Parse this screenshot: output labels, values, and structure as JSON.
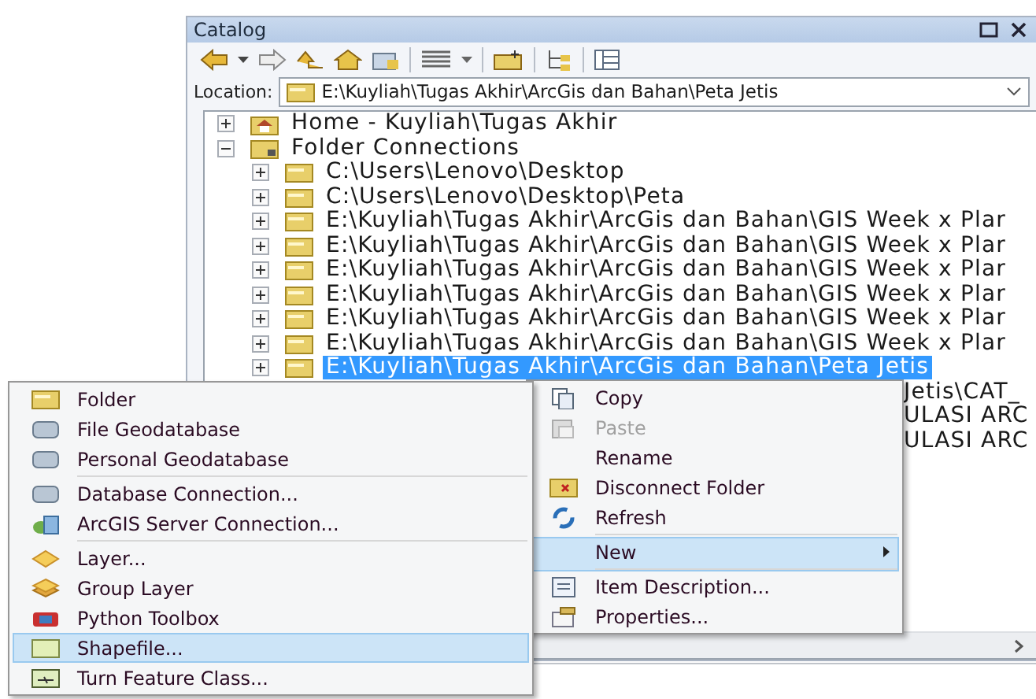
{
  "panel": {
    "title": "Catalog"
  },
  "location": {
    "label": "Location:",
    "value": "E:\\Kuyliah\\Tugas Akhir\\ArcGis dan Bahan\\Peta Jetis"
  },
  "tree": [
    {
      "label": "Home - Kuyliah\\Tugas Akhir",
      "kind": "home",
      "expanded": false,
      "selected": false
    },
    {
      "label": "Folder Connections",
      "kind": "connections",
      "expanded": true,
      "selected": false,
      "children": [
        {
          "label": "C:\\Users\\Lenovo\\Desktop",
          "kind": "folder",
          "expanded": false,
          "selected": false
        },
        {
          "label": "C:\\Users\\Lenovo\\Desktop\\Peta",
          "kind": "folder",
          "expanded": false,
          "selected": false
        },
        {
          "label": "E:\\Kuyliah\\Tugas Akhir\\ArcGis dan Bahan\\GIS Week x Plar",
          "kind": "folder",
          "expanded": false,
          "selected": false
        },
        {
          "label": "E:\\Kuyliah\\Tugas Akhir\\ArcGis dan Bahan\\GIS Week x Plar",
          "kind": "folder",
          "expanded": false,
          "selected": false
        },
        {
          "label": "E:\\Kuyliah\\Tugas Akhir\\ArcGis dan Bahan\\GIS Week x Plar",
          "kind": "folder",
          "expanded": false,
          "selected": false
        },
        {
          "label": "E:\\Kuyliah\\Tugas Akhir\\ArcGis dan Bahan\\GIS Week x Plar",
          "kind": "folder",
          "expanded": false,
          "selected": false
        },
        {
          "label": "E:\\Kuyliah\\Tugas Akhir\\ArcGis dan Bahan\\GIS Week x Plar",
          "kind": "folder",
          "expanded": false,
          "selected": false
        },
        {
          "label": "E:\\Kuyliah\\Tugas Akhir\\ArcGis dan Bahan\\GIS Week x Plar",
          "kind": "folder",
          "expanded": false,
          "selected": false
        },
        {
          "label": "E:\\Kuyliah\\Tugas Akhir\\ArcGis dan Bahan\\Peta Jetis",
          "kind": "folder",
          "expanded": false,
          "selected": true
        },
        {
          "label": "Jetis\\CAT_",
          "kind": "fragment"
        },
        {
          "label": "ULASI ARC",
          "kind": "fragment"
        },
        {
          "label": "ULASI ARC",
          "kind": "fragment"
        }
      ]
    }
  ],
  "context_menu": [
    {
      "label": "Copy",
      "kind": "copy",
      "disabled": false,
      "selected": false,
      "separator_after": false
    },
    {
      "label": "Paste",
      "kind": "paste",
      "disabled": true,
      "selected": false,
      "separator_after": false
    },
    {
      "label": "Rename",
      "kind": "plain",
      "disabled": false,
      "selected": false,
      "separator_after": false
    },
    {
      "label": "Disconnect Folder",
      "kind": "disconnect",
      "disabled": false,
      "selected": false,
      "separator_after": false
    },
    {
      "label": "Refresh",
      "kind": "refresh",
      "disabled": false,
      "selected": false,
      "separator_after": true
    },
    {
      "label": "New",
      "kind": "plain",
      "disabled": false,
      "selected": true,
      "separator_after": true,
      "submenu": true
    },
    {
      "label": "Item Description...",
      "kind": "description",
      "disabled": false,
      "selected": false,
      "separator_after": false
    },
    {
      "label": "Properties...",
      "kind": "properties",
      "disabled": false,
      "selected": false,
      "separator_after": false
    }
  ],
  "new_submenu": [
    {
      "label": "Folder",
      "kind": "folder",
      "selected": false,
      "separator_after": false
    },
    {
      "label": "File Geodatabase",
      "kind": "database",
      "selected": false,
      "separator_after": false
    },
    {
      "label": "Personal Geodatabase",
      "kind": "database",
      "selected": false,
      "separator_after": true
    },
    {
      "label": "Database Connection...",
      "kind": "database",
      "selected": false,
      "separator_after": false
    },
    {
      "label": "ArcGIS Server Connection...",
      "kind": "server",
      "selected": false,
      "separator_after": true
    },
    {
      "label": "Layer...",
      "kind": "layer",
      "selected": false,
      "separator_after": false
    },
    {
      "label": "Group Layer",
      "kind": "grouplayer",
      "selected": false,
      "separator_after": false
    },
    {
      "label": "Python Toolbox",
      "kind": "toolbox",
      "selected": false,
      "separator_after": false
    },
    {
      "label": "Shapefile...",
      "kind": "shapefile",
      "selected": true,
      "separator_after": false
    },
    {
      "label": "Turn Feature Class...",
      "kind": "featureclass",
      "selected": false,
      "separator_after": false
    }
  ]
}
